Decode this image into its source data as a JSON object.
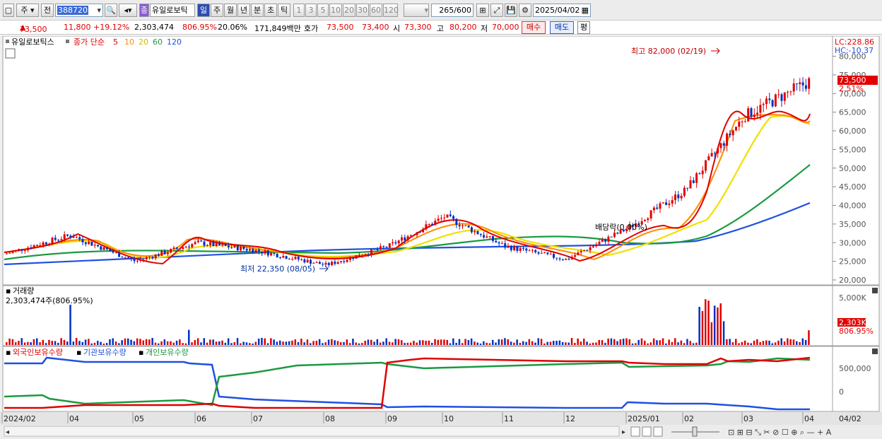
{
  "toolbar": {
    "period_main": "주",
    "prev_label": "전",
    "code": "388720",
    "stock_name": "유일로보틱",
    "periods": [
      "일",
      "주",
      "월",
      "년",
      "분",
      "초",
      "틱"
    ],
    "selected_period": "일",
    "intervals": [
      "1",
      "3",
      "5",
      "10",
      "20",
      "30",
      "60",
      "120"
    ],
    "count": "265",
    "count_max": "/600",
    "date": "2025/04/02"
  },
  "quote": {
    "price": "73,500",
    "change": "11,800",
    "change_pct": "+19.12%",
    "volume": "2,303,474",
    "volume_pct": "806.95%",
    "turnover_pct": "20.06%",
    "amount": "171,849백만",
    "hoga_label": "호가",
    "ask": "73,500",
    "bid": "73,400",
    "open_label": "시",
    "open": "73,300",
    "high_label": "고",
    "high": "80,200",
    "low_label": "저",
    "low": "70,000",
    "buy_label": "매수",
    "sell_label": "매도",
    "avg_label": "평"
  },
  "price_panel": {
    "title": "유일로보틱스",
    "ma_label": "종가 단순",
    "ma_periods": [
      "5",
      "10",
      "20",
      "60",
      "120"
    ],
    "ma_colors": [
      "#e00000",
      "#ff8c00",
      "#f0e000",
      "#1a9a40",
      "#2050e0"
    ],
    "lc": "LC:228.86",
    "hc": "HC:-10.37",
    "price_tag": "73,500",
    "price_tag_pct": "2.51%",
    "high_note": "최고 82,000 (02/19)",
    "low_note": "최저 22,350 (08/05)",
    "dividend_note": "배당락(0.00%)",
    "axis": [
      "80,000",
      "75,000",
      "70,000",
      "65,000",
      "60,000",
      "55,000",
      "50,000",
      "45,000",
      "40,000",
      "35,000",
      "30,000",
      "25,000",
      "20,000"
    ]
  },
  "volume_panel": {
    "title": "거래량",
    "subtitle": "2,303,474주(806.95%)",
    "axis_top": "5,000K",
    "tag": "2,303K",
    "tag_pct": "806.95%"
  },
  "holdings_panel": {
    "legends": [
      "외국인보유수량",
      "기관보유수량",
      "개인보유수량"
    ],
    "legend_colors": [
      "#e00000",
      "#2050e0",
      "#1a9a40"
    ],
    "axis": [
      "500,000",
      "0"
    ]
  },
  "xaxis": [
    "2024/02",
    "04",
    "05",
    "06",
    "07",
    "08",
    "09",
    "10",
    "11",
    "12",
    "2025/01",
    "02",
    "03",
    "04",
    "04/02"
  ],
  "chart_data": {
    "type": "candlestick",
    "price_ylim": [
      20000,
      82000
    ],
    "close_series": [
      {
        "label": "2024/02",
        "value": 27000
      },
      {
        "label": "04",
        "value": 32000
      },
      {
        "label": "05",
        "value": 25000
      },
      {
        "label": "06",
        "value": 30000
      },
      {
        "label": "07",
        "value": 28000
      },
      {
        "label": "08",
        "value": 24000
      },
      {
        "label": "09",
        "value": 29000
      },
      {
        "label": "10",
        "value": 37000
      },
      {
        "label": "11",
        "value": 29000
      },
      {
        "label": "12",
        "value": 25500
      },
      {
        "label": "2025/01",
        "value": 34000
      },
      {
        "label": "02",
        "value": 44000
      },
      {
        "label": "03",
        "value": 64000
      },
      {
        "label": "04",
        "value": 73500
      }
    ]
  }
}
